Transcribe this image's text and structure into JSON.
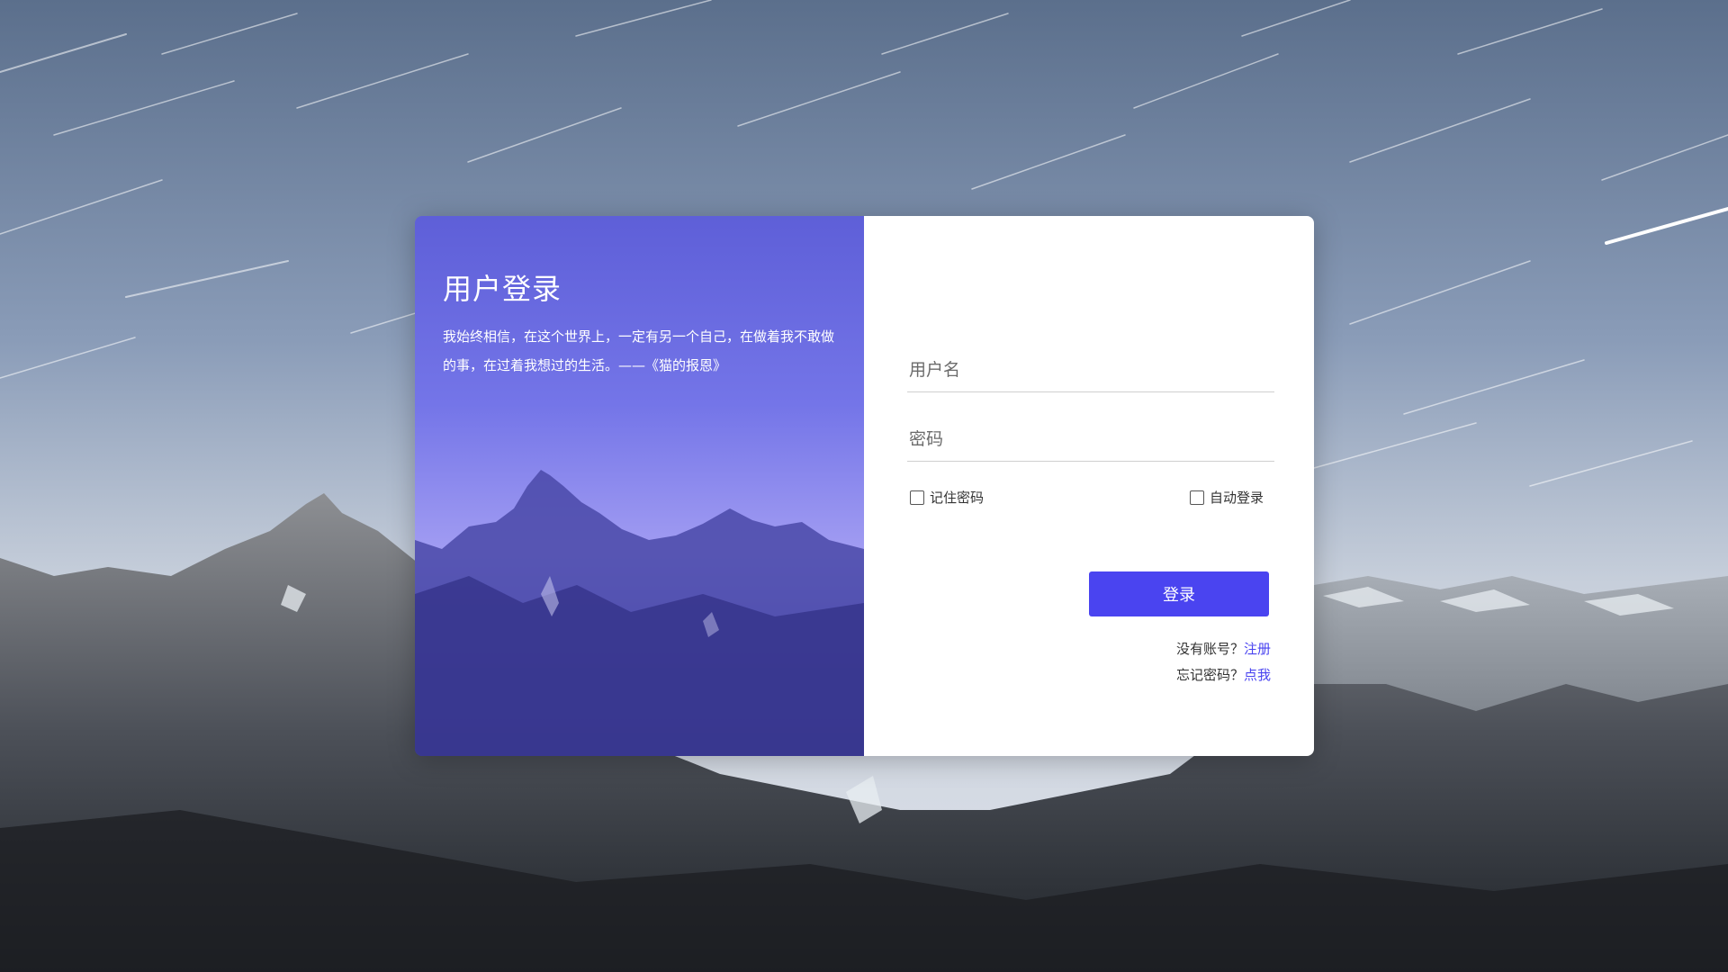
{
  "colors": {
    "accent": "#4a44f0",
    "panel_gradient_top": "#5e5fd8",
    "panel_gradient_mid": "#a19cf2",
    "panel_gradient_bottom": "#3d3c96"
  },
  "icons": {
    "checkbox": "empty-checkbox-icon"
  },
  "left_panel": {
    "title": "用户登录",
    "quote": "我始终相信，在这个世界上，一定有另一个自己，在做着我不敢做的事，在过着我想过的生活。——《猫的报恩》"
  },
  "form": {
    "username": {
      "placeholder": "用户名",
      "value": ""
    },
    "password": {
      "placeholder": "密码",
      "value": ""
    },
    "remember_label": "记住密码",
    "remember_checked": false,
    "auto_label": "自动登录",
    "auto_checked": false,
    "submit_label": "登录",
    "register_prompt": "没有账号？",
    "register_link": "注册",
    "forgot_prompt": "忘记密码？",
    "forgot_link": "点我"
  }
}
